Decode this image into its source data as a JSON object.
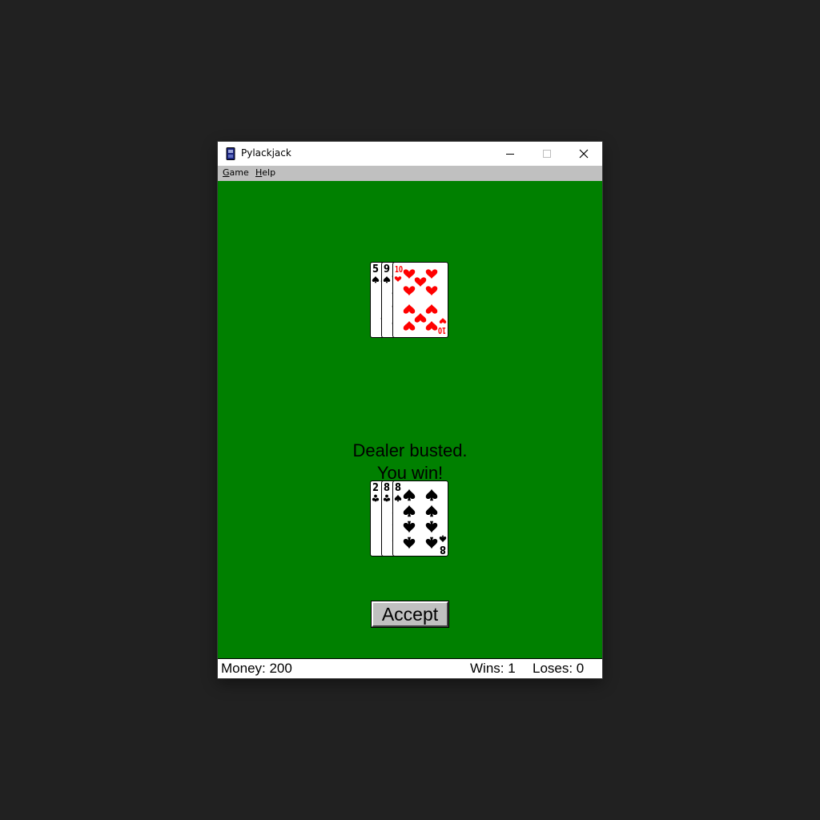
{
  "window": {
    "title": "Pylackjack",
    "icon": "card-game-icon",
    "controls": [
      "minimize-icon",
      "maximize-icon",
      "close-icon"
    ]
  },
  "menu": {
    "game": {
      "accel": "G",
      "rest": "ame"
    },
    "help": {
      "accel": "H",
      "rest": "elp"
    }
  },
  "dealer_hand": [
    {
      "rank": "5",
      "suit": "spades"
    },
    {
      "rank": "9",
      "suit": "spades"
    },
    {
      "rank": "10",
      "suit": "hearts"
    }
  ],
  "player_hand": [
    {
      "rank": "2",
      "suit": "clubs"
    },
    {
      "rank": "8",
      "suit": "clubs"
    },
    {
      "rank": "8",
      "suit": "spades"
    }
  ],
  "message": {
    "line1": "Dealer busted.",
    "line2": "You win!"
  },
  "accept_button": {
    "label": "Accept"
  },
  "status": {
    "money": "Money: 200",
    "wins": "Wins: 1",
    "loses": "Loses: 0"
  },
  "colors": {
    "felt": "#008000",
    "menubar": "#c0c0c0",
    "red_suit": "#ff0000",
    "black_suit": "#000000"
  }
}
